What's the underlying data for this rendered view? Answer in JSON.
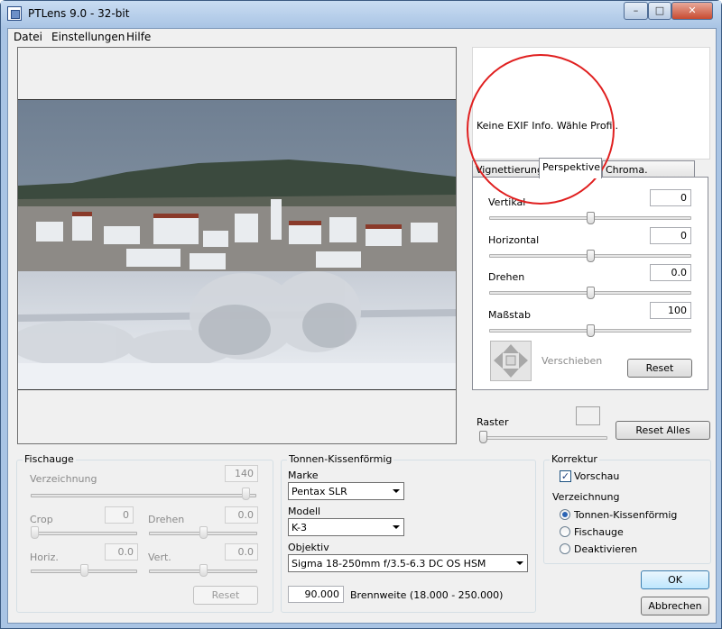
{
  "window": {
    "title": "PTLens 9.0 - 32-bit",
    "min_label": "–",
    "max_label": "□",
    "close_label": "✕"
  },
  "menu": [
    "Datei",
    "Einstellungen",
    "Hilfe"
  ],
  "exif": {
    "message": "Keine EXIF Info. Wähle Profil."
  },
  "tabs": {
    "items": [
      "Vignettierung",
      "Perspektive",
      "Chroma. Aberration"
    ],
    "active": "Perspektive"
  },
  "perspective": {
    "vertical": {
      "label": "Vertikal",
      "value": "0",
      "level": 0.5
    },
    "horizontal": {
      "label": "Horizontal",
      "value": "0",
      "level": 0.5
    },
    "rotate": {
      "label": "Drehen",
      "value": "0.0",
      "level": 0.5
    },
    "scale": {
      "label": "Maßstab",
      "value": "100",
      "level": 0.5
    },
    "shift_label": "Verschieben",
    "reset_label": "Reset"
  },
  "raster": {
    "label": "Raster",
    "level": 0
  },
  "reset_all_label": "Reset Alles",
  "fisheye": {
    "title": "Fischauge",
    "distortion": {
      "label": "Verzeichnung",
      "value": "140",
      "level": 0.97
    },
    "crop": {
      "label": "Crop",
      "value": "0",
      "level": 0
    },
    "rotate": {
      "label": "Drehen",
      "value": "0.0",
      "level": 0.5
    },
    "horiz": {
      "label": "Horiz.",
      "value": "0.0",
      "level": 0.5
    },
    "vert": {
      "label": "Vert.",
      "value": "0.0",
      "level": 0.5
    },
    "reset_label": "Reset"
  },
  "barrel": {
    "title": "Tonnen-Kissenförmig",
    "make": {
      "label": "Marke",
      "value": "Pentax SLR"
    },
    "model": {
      "label": "Modell",
      "value": "K-3"
    },
    "lens": {
      "label": "Objektiv",
      "value": "Sigma 18-250mm f/3.5-6.3 DC OS HSM"
    },
    "focal_value": "90.000",
    "focal_label": "Brennweite (18.000 - 250.000)"
  },
  "correction": {
    "title": "Korrektur",
    "preview_label": "Vorschau",
    "preview_checked": true,
    "distortion_label": "Verzeichnung",
    "options": [
      "Tonnen-Kissenförmig",
      "Fischauge",
      "Deaktivieren"
    ],
    "selected": "Tonnen-Kissenförmig"
  },
  "ok_label": "OK",
  "cancel_label": "Abbrechen",
  "colors": {
    "annotation_circle": "#e02020",
    "title_bar": "#a9c4e4"
  }
}
